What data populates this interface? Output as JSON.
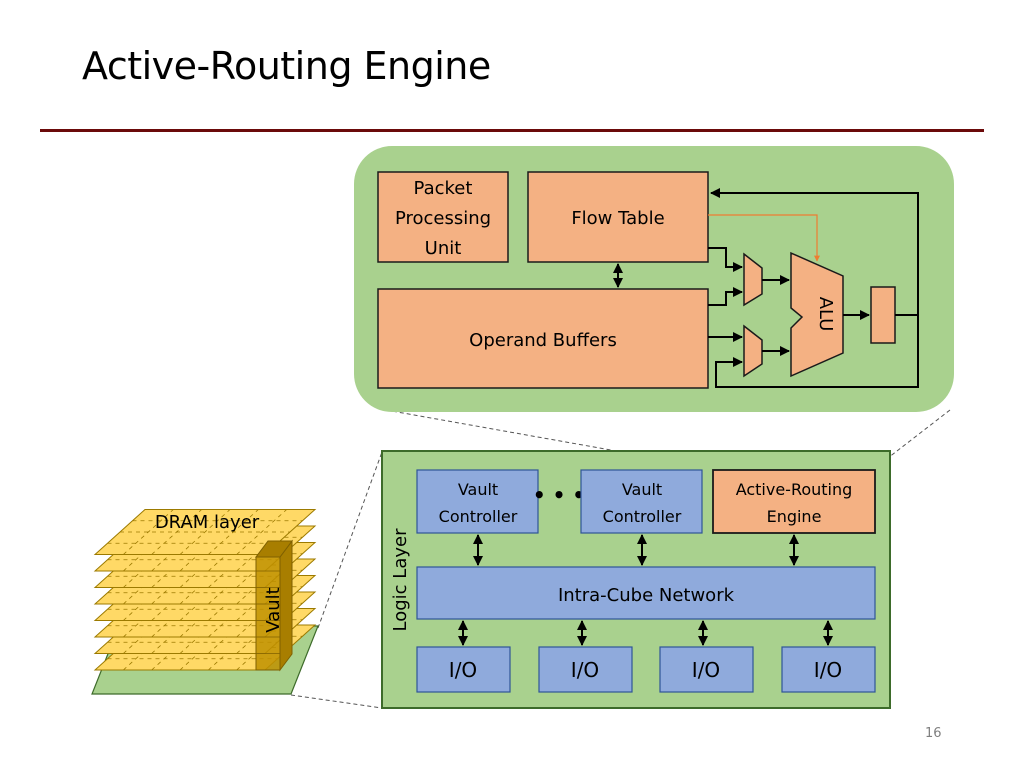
{
  "slide": {
    "title": "Active-Routing Engine",
    "page_number": "16"
  },
  "engine": {
    "packet_processing_unit": [
      "Packet",
      "Processing",
      "Unit"
    ],
    "flow_table": "Flow Table",
    "operand_buffers": "Operand Buffers",
    "alu": "ALU"
  },
  "logic_layer": {
    "label": "Logic Layer",
    "vault_controllers": [
      [
        "Vault",
        "Controller"
      ],
      [
        "Vault",
        "Controller"
      ]
    ],
    "ellipsis": "• • •",
    "active_routing_engine": [
      "Active-Routing",
      "Engine"
    ],
    "network": "Intra-Cube Network",
    "io_ports": [
      "I/O",
      "I/O",
      "I/O",
      "I/O"
    ]
  },
  "stack": {
    "dram_label": "DRAM layer",
    "vault_label": "Vault"
  },
  "colors": {
    "green_bg": "#a9d18e",
    "orange_box": "#f4b183",
    "blue_box": "#8faadc",
    "dram_yellow": "#ffd966",
    "vault_dark": "#bf9000",
    "accent_line": "#6b0a0a",
    "orange_arrow": "#ed7d31"
  }
}
